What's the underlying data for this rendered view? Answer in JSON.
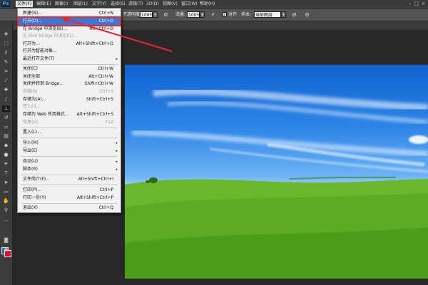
{
  "app": {
    "logo": "Ps"
  },
  "menubar": {
    "items": [
      "文件(F)",
      "编辑(E)",
      "图像(I)",
      "图层(L)",
      "文字(Y)",
      "选择(S)",
      "滤镜(T)",
      "3D(D)",
      "视图(V)",
      "窗口(W)",
      "帮助(H)"
    ]
  },
  "window_controls": {
    "minimize": "–",
    "restore": "□",
    "close": "×"
  },
  "options": {
    "opacity_label": "不透明度:",
    "opacity_value": "100%",
    "flow_label": "流量:",
    "flow_value": "100%",
    "align_label": "对齐",
    "sample_label": "样本:",
    "sample_value": "当前图层"
  },
  "file_menu": {
    "items": [
      {
        "label": "新建(N)...",
        "shortcut": "Ctrl+N"
      },
      {
        "label": "打开(O)...",
        "shortcut": "Ctrl+O",
        "highlighted": true
      },
      {
        "label": "在 Bridge 中浏览(B)...",
        "shortcut": "Alt+Ctrl+O"
      },
      {
        "label": "在 Mini Bridge 中浏览(G)...",
        "shortcut": "",
        "disabled": true
      },
      {
        "label": "打开为...",
        "shortcut": "Alt+Shift+Ctrl+O"
      },
      {
        "label": "打开为智能对象...",
        "shortcut": ""
      },
      {
        "label": "最近打开文件(T)",
        "shortcut": "",
        "submenu": true
      },
      {
        "label": "关闭(C)",
        "shortcut": "Ctrl+W"
      },
      {
        "label": "关闭全部",
        "shortcut": "Alt+Ctrl+W"
      },
      {
        "label": "关闭并转到 Bridge...",
        "shortcut": "Shift+Ctrl+W"
      },
      {
        "label": "存储(S)",
        "shortcut": "Ctrl+S",
        "disabled": true
      },
      {
        "label": "存储为(A)...",
        "shortcut": "Shift+Ctrl+S"
      },
      {
        "label": "签入(I)...",
        "shortcut": "",
        "disabled": true
      },
      {
        "label": "存储为 Web 所用格式...",
        "shortcut": "Alt+Shift+Ctrl+S"
      },
      {
        "label": "恢复(V)",
        "shortcut": "F12",
        "disabled": true
      },
      {
        "label": "置入(L)...",
        "shortcut": ""
      },
      {
        "label": "导入(M)",
        "shortcut": "",
        "submenu": true
      },
      {
        "label": "导出(E)",
        "shortcut": "",
        "submenu": true
      },
      {
        "label": "自动(U)",
        "shortcut": "",
        "submenu": true
      },
      {
        "label": "脚本(R)",
        "shortcut": "",
        "submenu": true
      },
      {
        "label": "文件简介(F)...",
        "shortcut": "Alt+Shift+Ctrl+I"
      },
      {
        "label": "打印(P)...",
        "shortcut": "Ctrl+P"
      },
      {
        "label": "打印一份(Y)",
        "shortcut": "Alt+Shift+Ctrl+P"
      },
      {
        "label": "退出(X)",
        "shortcut": "Ctrl+Q"
      }
    ],
    "submenu_arrow": "▸"
  },
  "colors": {
    "highlight": "#3a78d4",
    "annotation_red": "#e8272e",
    "foreground": "#1f6fbe",
    "background": "#e0102a"
  }
}
